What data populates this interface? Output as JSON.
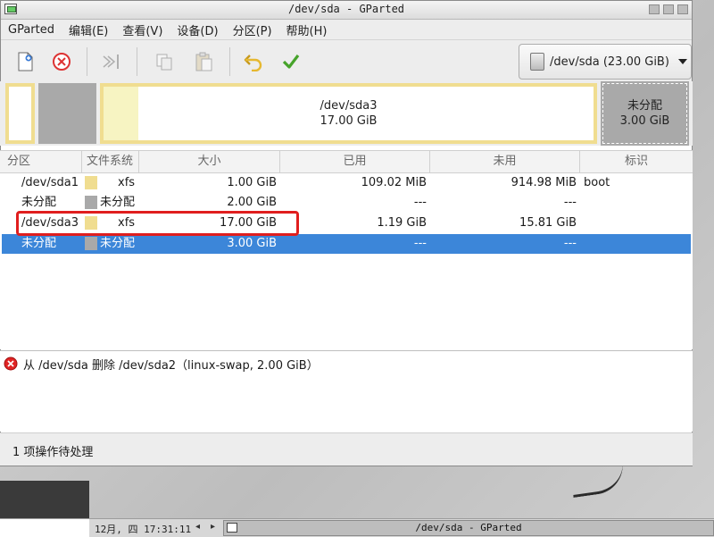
{
  "window": {
    "title": "/dev/sda - GParted"
  },
  "menubar": {
    "items": [
      "GParted",
      "编辑(E)",
      "查看(V)",
      "设备(D)",
      "分区(P)",
      "帮助(H)"
    ]
  },
  "toolbar": {
    "icons": [
      "new-partition-icon",
      "delete-icon",
      "resize-move-icon",
      "copy-icon",
      "paste-icon",
      "undo-icon",
      "apply-icon"
    ],
    "device_label": "/dev/sda (23.00 GiB)"
  },
  "partition_map": {
    "sda3_name": "/dev/sda3",
    "sda3_size": "17.00 GiB",
    "unalloc_name": "未分配",
    "unalloc_size": "3.00 GiB"
  },
  "table": {
    "headers": [
      "分区",
      "文件系统",
      "大小",
      "已用",
      "未用",
      "标识"
    ],
    "rows": [
      {
        "partition": "/dev/sda1",
        "fs": "xfs",
        "size": "1.00 GiB",
        "used": "109.02 MiB",
        "unused": "914.98 MiB",
        "flags": "boot"
      },
      {
        "partition": "未分配",
        "fs": "未分配",
        "size": "2.00 GiB",
        "used": "---",
        "unused": "---",
        "flags": ""
      },
      {
        "partition": "/dev/sda3",
        "fs": "xfs",
        "size": "17.00 GiB",
        "used": "1.19 GiB",
        "unused": "15.81 GiB",
        "flags": ""
      },
      {
        "partition": "未分配",
        "fs": "未分配",
        "size": "3.00 GiB",
        "used": "---",
        "unused": "---",
        "flags": ""
      }
    ]
  },
  "operations": {
    "items": [
      "从 /dev/sda 删除 /dev/sda2（linux-swap, 2.00 GiB）"
    ]
  },
  "status": {
    "text": "1 项操作待处理"
  },
  "taskbar": {
    "clock": "12月, 四 17:31:11",
    "task_title": "/dev/sda - GParted"
  },
  "colors": {
    "xfs": "#f0dd90",
    "unallocated": "#a9a9a9",
    "selection": "#3c86d9",
    "highlight": "#e01e1e"
  }
}
